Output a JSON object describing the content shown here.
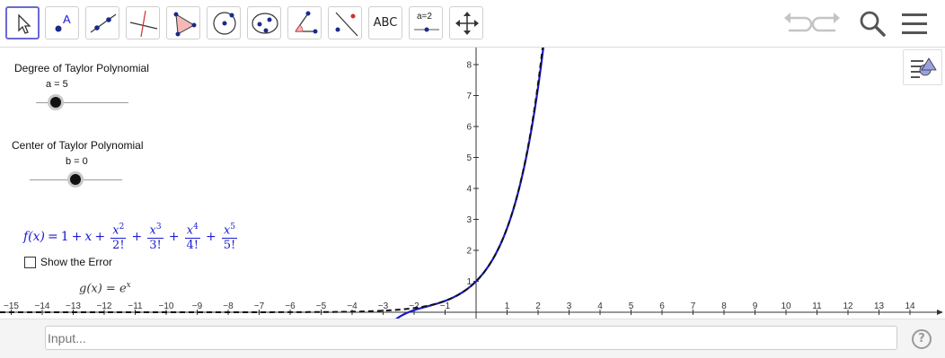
{
  "toolbar": {
    "point_label": "A",
    "text_tool_label": "ABC",
    "slider_tool_label": "a=2"
  },
  "sliders": [
    {
      "title": "Degree of Taylor Polynomial",
      "value_text": "a = 5",
      "min": 0,
      "max": 10,
      "value": 5
    },
    {
      "title": "Center of Taylor Polynomial",
      "value_text": "b = 0",
      "min": -5,
      "max": 5,
      "value": 0
    }
  ],
  "formula": {
    "lhs": "f(x)",
    "terms": [
      "1",
      "x"
    ],
    "fractions": [
      {
        "num": "x",
        "exp": "2",
        "den": "2!"
      },
      {
        "num": "x",
        "exp": "3",
        "den": "3!"
      },
      {
        "num": "x",
        "exp": "4",
        "den": "4!"
      },
      {
        "num": "x",
        "exp": "5",
        "den": "5!"
      }
    ]
  },
  "error_checkbox": {
    "label": "Show the Error",
    "checked": false
  },
  "g_function": {
    "text": "g(x)  =  e",
    "exp": "x"
  },
  "axes": {
    "x_ticks": [
      "-15",
      "-14",
      "-13",
      "-12",
      "-11",
      "-10",
      "-9",
      "-8",
      "-7",
      "-6",
      "-5",
      "-4",
      "-3",
      "-2",
      "-1",
      "1",
      "2",
      "3",
      "4",
      "5",
      "6",
      "7",
      "8",
      "9",
      "10",
      "11",
      "12",
      "13",
      "14"
    ],
    "y_ticks": [
      "1",
      "2",
      "3",
      "4",
      "5",
      "6",
      "7",
      "8"
    ]
  },
  "curves": {
    "taylor_color": "#1a1ad0",
    "exp_color": "#111111"
  },
  "input": {
    "placeholder": "Input..."
  },
  "help": {
    "label": "?"
  }
}
